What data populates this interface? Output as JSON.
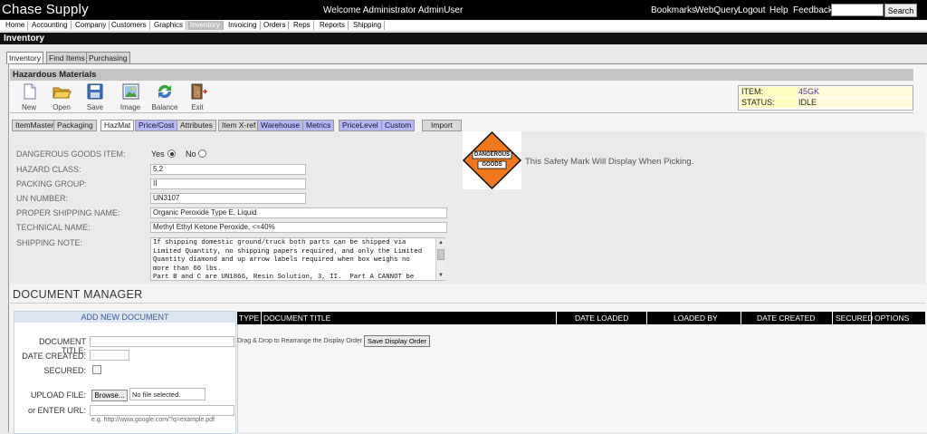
{
  "header": {
    "brand": "Chase Supply",
    "welcome": "Welcome  Administrator AdminUser",
    "links": [
      "Bookmarks",
      "WebQuery",
      "Logout",
      "Help",
      "Feedback"
    ],
    "search_button": "Search"
  },
  "nav": {
    "items": [
      "Home",
      "Accounting",
      "Company",
      "Customers",
      "Graphics",
      "Inventory",
      "Invoicing",
      "Orders",
      "Reps",
      "Reports",
      "Shipping"
    ],
    "active": "Inventory"
  },
  "section_title": "Inventory",
  "tabs": [
    "Inventory",
    "Find Items",
    "Purchasing"
  ],
  "panel_title": "Hazardous Materials",
  "toolbar": [
    "New",
    "Open",
    "Save",
    "Image",
    "Balance",
    "Exit"
  ],
  "item_info": {
    "item_label": "ITEM:",
    "item_value": "45GK",
    "status_label": "STATUS:",
    "status_value": "IDLE"
  },
  "subtabs": [
    "ItemMaster",
    "Packaging",
    "HazMat",
    "Price/Cost",
    "Attributes",
    "Item X-ref",
    "Warehouse",
    "Metrics",
    "PriceLevel",
    "Custom",
    "Import"
  ],
  "hazmat": {
    "dangerous_label": "DANGEROUS GOODS ITEM:",
    "yes_label": "Yes",
    "no_label": "No",
    "hazard_class_label": "HAZARD CLASS:",
    "hazard_class": "5.2",
    "packing_group_label": "PACKING GROUP:",
    "packing_group": "II",
    "un_number_label": "UN NUMBER:",
    "un_number": "UN3107",
    "proper_name_label": "PROPER SHIPPING NAME:",
    "proper_name": "Organic Peroxide Type E, Liquid",
    "technical_name_label": "TECHNICAL NAME:",
    "technical_name": "Methyl Ethyl Ketone Peroxide, <=40%",
    "shipping_note_label": "SHIPPING NOTE:",
    "shipping_note": "If shipping domestic ground/truck both parts can be shipped via\nLimited Quantity, no shipping papers required, and only the Limited\nQuantity diamond and up arrow labels required when box weighs no\nmore than 66 lbs.\nPart B and C are UN1866, Resin Solution, 3, II.  Part A CANNOT be",
    "diamond_line1": "DANGEROUS",
    "diamond_line2": "GOODS",
    "safety_mark_text": "This Safety Mark Will Display When Picking."
  },
  "document_manager": {
    "title": "DOCUMENT MANAGER",
    "add_header": "ADD NEW DOCUMENT",
    "doc_title_label": "DOCUMENT TITLE:",
    "date_created_label": "DATE CREATED:",
    "secured_label": "SECURED:",
    "upload_label": "UPLOAD FILE:",
    "browse_label": "Browse...",
    "no_file": "No file selected.",
    "url_label": "or ENTER URL:",
    "url_hint": "e.g. http://www.google.com/?q=example.pdf",
    "columns": [
      "TYPE",
      "DOCUMENT TITLE",
      "DATE LOADED",
      "LOADED BY",
      "DATE CREATED",
      "SECURED",
      "OPTIONS"
    ],
    "drag_text": "Drag & Drop to Rearrange the Display Order",
    "save_order": "Save Display Order"
  },
  "colors": {
    "accent_blue_tab": "#b6b6f2",
    "hazmat_orange": "#f2781e",
    "hazmat_black": "#111111",
    "info_yellow": "#fffcc0"
  }
}
